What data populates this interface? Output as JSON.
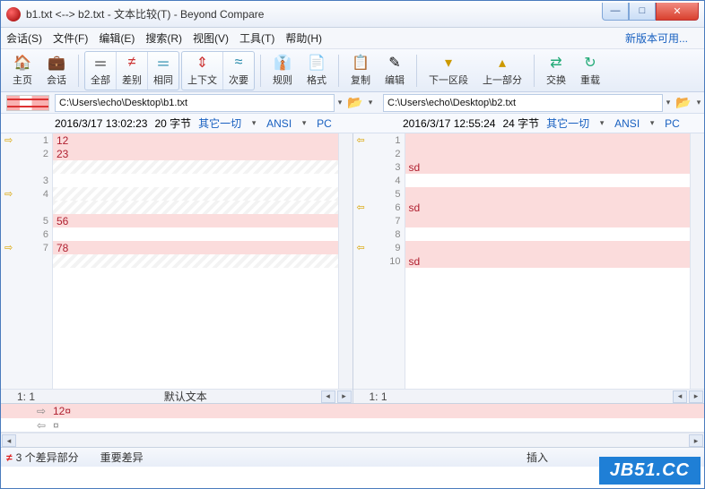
{
  "window": {
    "title": "b1.txt <--> b2.txt - 文本比较(T) - Beyond Compare"
  },
  "menu": {
    "items": [
      "会话(S)",
      "文件(F)",
      "编辑(E)",
      "搜索(R)",
      "视图(V)",
      "工具(T)",
      "帮助(H)"
    ],
    "update": "新版本可用..."
  },
  "toolbar": {
    "home": "主页",
    "session": "会话",
    "all": "全部",
    "diff": "差别",
    "same": "相同",
    "ctx": "上下文",
    "minor": "次要",
    "rules": "规则",
    "format": "格式",
    "copy": "复制",
    "edit": "编辑",
    "nextsec": "下一区段",
    "prevsec": "上一部分",
    "swap": "交换",
    "reload": "重载"
  },
  "left": {
    "path": "C:\\Users\\echo\\Desktop\\b1.txt",
    "date": "2016/3/17 13:02:23",
    "size": "20 字节",
    "misc": "其它一切",
    "enc": "ANSI",
    "eol": "PC",
    "lines": [
      {
        "n": "1",
        "txt": "12",
        "cls": "diff",
        "arr": "⇨"
      },
      {
        "n": "2",
        "txt": "23",
        "cls": "diff",
        "arr": ""
      },
      {
        "n": "",
        "txt": "",
        "cls": "hatch",
        "arr": ""
      },
      {
        "n": "3",
        "txt": "",
        "cls": "",
        "arr": ""
      },
      {
        "n": "4",
        "txt": "",
        "cls": "hatch",
        "arr": "⇨"
      },
      {
        "n": "",
        "txt": "",
        "cls": "hatch",
        "arr": ""
      },
      {
        "n": "5",
        "txt": "56",
        "cls": "diff",
        "arr": ""
      },
      {
        "n": "6",
        "txt": "",
        "cls": "",
        "arr": ""
      },
      {
        "n": "7",
        "txt": "78",
        "cls": "diff",
        "arr": "⇨"
      },
      {
        "n": "",
        "txt": "",
        "cls": "hatch",
        "arr": ""
      }
    ],
    "pos": "1: 1",
    "mode": "默认文本"
  },
  "right": {
    "path": "C:\\Users\\echo\\Desktop\\b2.txt",
    "date": "2016/3/17 12:55:24",
    "size": "24 字节",
    "misc": "其它一切",
    "enc": "ANSI",
    "eol": "PC",
    "lines": [
      {
        "n": "1",
        "txt": "",
        "cls": "diff",
        "arr": "⇦"
      },
      {
        "n": "2",
        "txt": "",
        "cls": "diff",
        "arr": ""
      },
      {
        "n": "3",
        "txt": "sd",
        "cls": "diff",
        "arr": ""
      },
      {
        "n": "4",
        "txt": "",
        "cls": "",
        "arr": ""
      },
      {
        "n": "5",
        "txt": "",
        "cls": "diff",
        "arr": ""
      },
      {
        "n": "6",
        "txt": "sd",
        "cls": "diff",
        "arr": "⇦"
      },
      {
        "n": "7",
        "txt": "",
        "cls": "diff",
        "arr": ""
      },
      {
        "n": "8",
        "txt": "",
        "cls": "",
        "arr": ""
      },
      {
        "n": "9",
        "txt": "",
        "cls": "diff",
        "arr": "⇦"
      },
      {
        "n": "10",
        "txt": "sd",
        "cls": "diff",
        "arr": ""
      }
    ],
    "pos": "1: 1"
  },
  "inline": {
    "l1": "12¤",
    "l2": "¤"
  },
  "status": {
    "diffs": "3 个差异部分",
    "major": "重要差异",
    "ins": "插入"
  },
  "watermark": "JB51.CC"
}
